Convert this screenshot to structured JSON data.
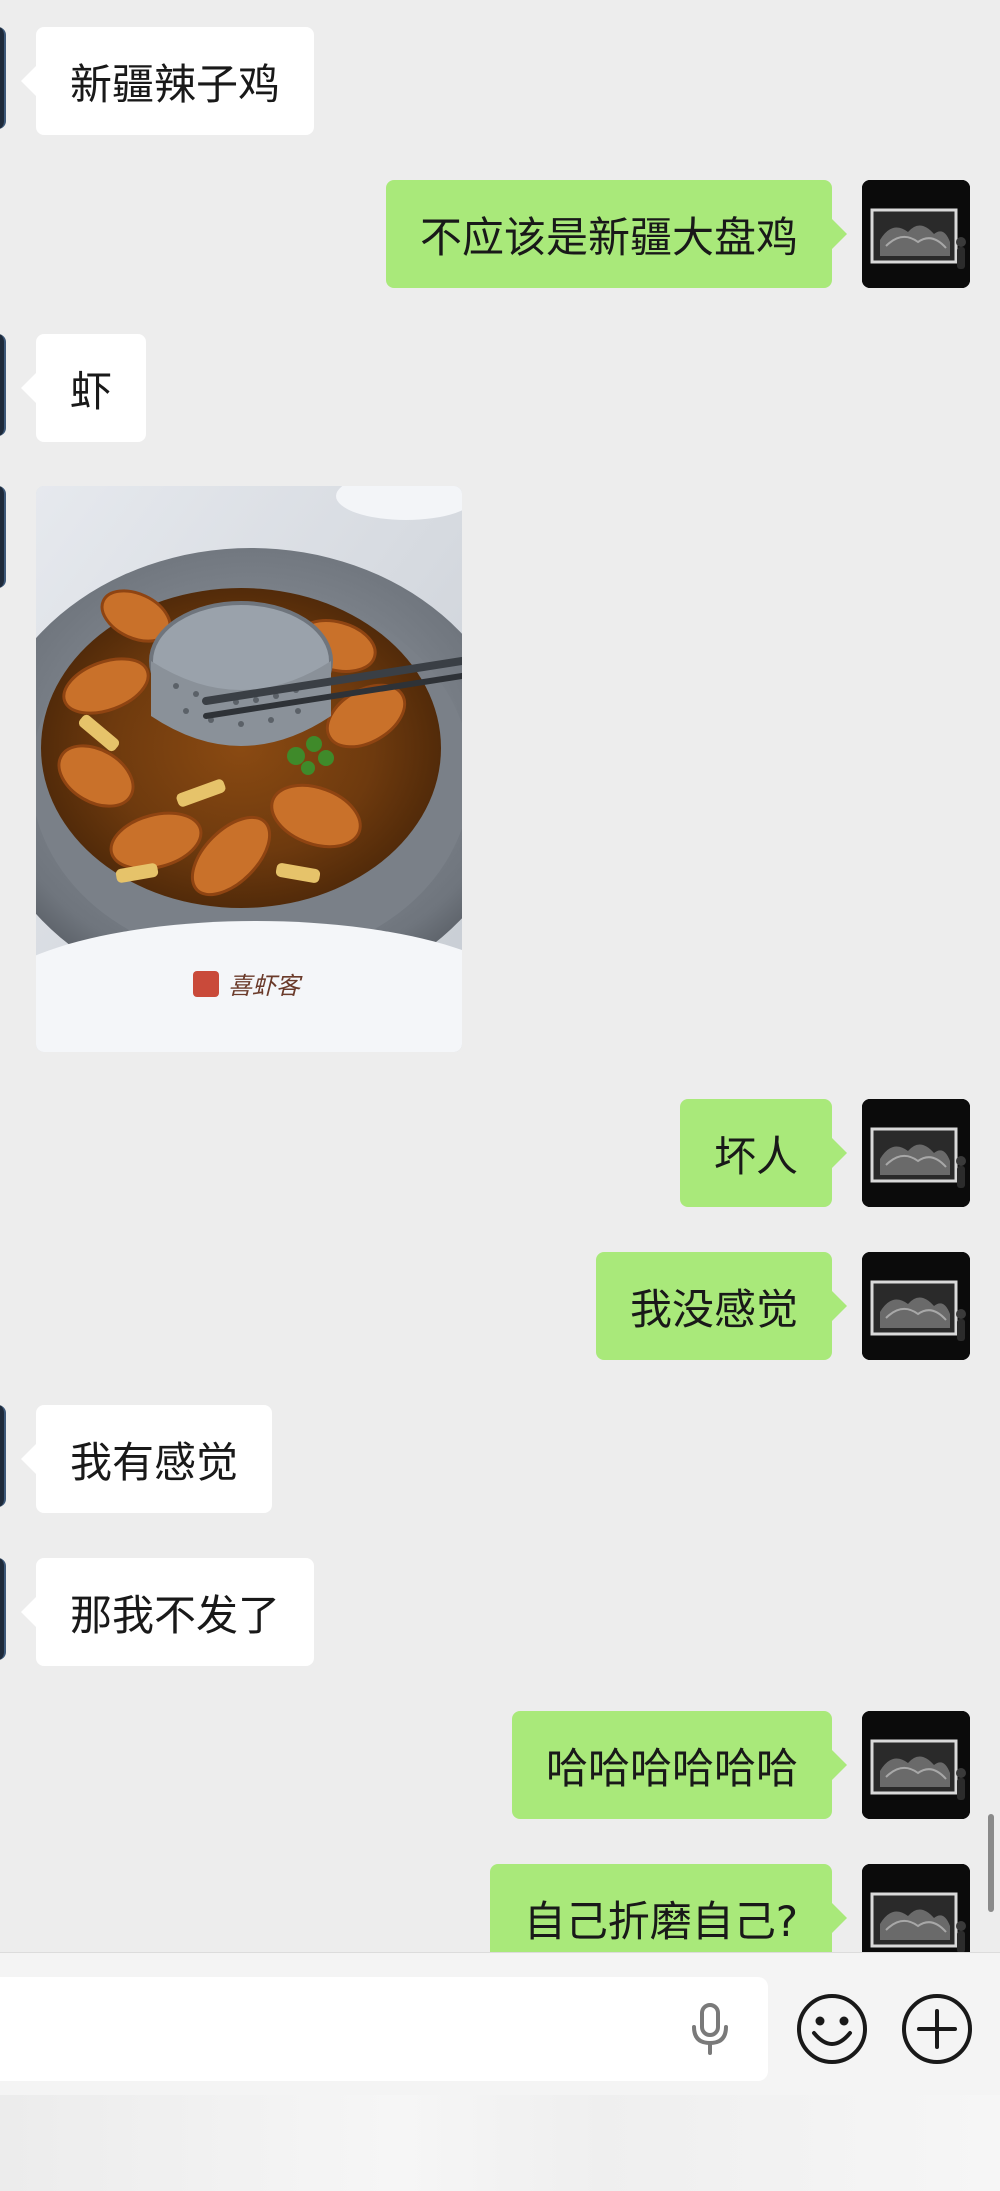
{
  "messages": [
    {
      "direction": "in",
      "type": "text",
      "text": "新疆辣子鸡"
    },
    {
      "direction": "out",
      "type": "text",
      "text": "不应该是新疆大盘鸡"
    },
    {
      "direction": "in",
      "type": "text",
      "text": "虾"
    },
    {
      "direction": "in",
      "type": "image",
      "image_text": "喜虾客"
    },
    {
      "direction": "out",
      "type": "text",
      "text": "坏人"
    },
    {
      "direction": "out",
      "type": "text",
      "text": "我没感觉"
    },
    {
      "direction": "in",
      "type": "text",
      "text": "我有感觉"
    },
    {
      "direction": "in",
      "type": "text",
      "text": "那我不发了"
    },
    {
      "direction": "out",
      "type": "text",
      "text": "哈哈哈哈哈哈"
    },
    {
      "direction": "out",
      "type": "text",
      "text": "自己折磨自己?"
    }
  ],
  "input_bar": {
    "value": "",
    "icons": [
      "mic-icon",
      "emoji-icon",
      "plus-icon"
    ]
  },
  "colors": {
    "background": "#ededed",
    "outgoing_bubble": "#a9e97a",
    "incoming_bubble": "#ffffff",
    "text": "#191919"
  }
}
